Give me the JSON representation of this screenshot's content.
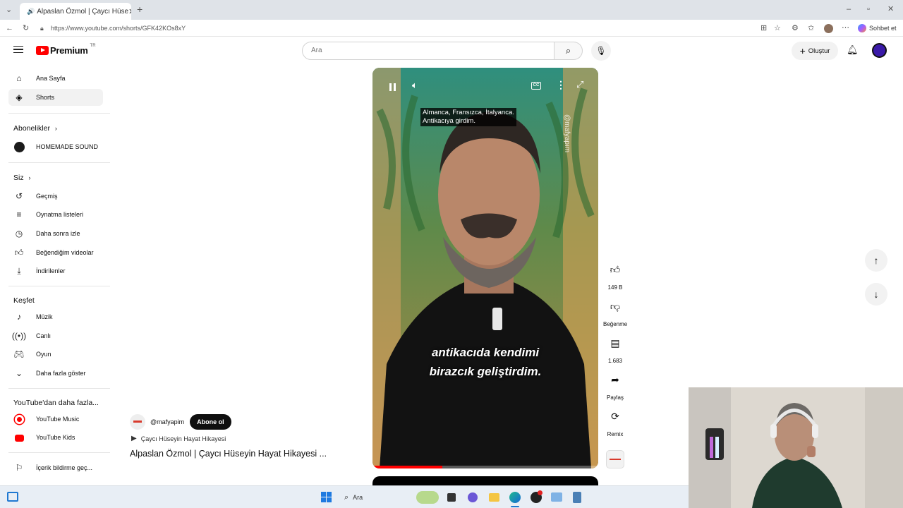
{
  "browser": {
    "tab_title": "Alpaslan Özmol | Çaycı Hüse",
    "url": "https://www.youtube.com/shorts/GFK42KOs8xY",
    "copilot_label": "Sohbet et"
  },
  "header": {
    "logo_text": "Premium",
    "region": "TR",
    "search_placeholder": "Ara",
    "create_label": "Oluştur"
  },
  "sidebar": {
    "main": [
      {
        "icon": "home-icon",
        "label": "Ana Sayfa"
      },
      {
        "icon": "shorts-icon",
        "label": "Shorts"
      }
    ],
    "subscriptions_title": "Abonelikler",
    "subscriptions": [
      {
        "label": "HOMEMADE SOUND"
      }
    ],
    "you_title": "Siz",
    "you": [
      {
        "icon": "history-icon",
        "label": "Geçmiş"
      },
      {
        "icon": "playlist-icon",
        "label": "Oynatma listeleri"
      },
      {
        "icon": "watch-later-icon",
        "label": "Daha sonra izle"
      },
      {
        "icon": "liked-icon",
        "label": "Beğendiğim videolar"
      },
      {
        "icon": "download-icon",
        "label": "İndirilenler"
      }
    ],
    "explore_title": "Keşfet",
    "explore": [
      {
        "icon": "music-icon",
        "label": "Müzik"
      },
      {
        "icon": "live-icon",
        "label": "Canlı"
      },
      {
        "icon": "gaming-icon",
        "label": "Oyun"
      },
      {
        "icon": "chevron-down-icon",
        "label": "Daha fazla göster"
      }
    ],
    "more_title": "YouTube'dan daha fazla...",
    "more": [
      {
        "label": "YouTube Music"
      },
      {
        "label": "YouTube Kids"
      }
    ],
    "report_label": "İçerik bildirme geç..."
  },
  "video": {
    "caption_top_line1": "Almanca, Fransızca, İtalyanca.",
    "caption_top_line2": "Antikacıya girdim.",
    "subtitle_line1": "antikacıda kendimi",
    "subtitle_line2": "birazcık geliştirdim.",
    "watermark": "@mafyapım",
    "progress": 0.31,
    "channel": "@mafyapim",
    "subscribe_label": "Abone ol",
    "music_label": "Çaycı Hüseyin Hayat Hikayesi",
    "title": "Alpaslan Özmol | Çaycı Hüseyin Hayat Hikayesi ..."
  },
  "actions": {
    "like_count": "149 B",
    "dislike_label": "Beğenme",
    "comment_count": "1.683",
    "share_label": "Paylaş",
    "remix_label": "Remix"
  },
  "taskbar": {
    "search_label": "Ara"
  }
}
